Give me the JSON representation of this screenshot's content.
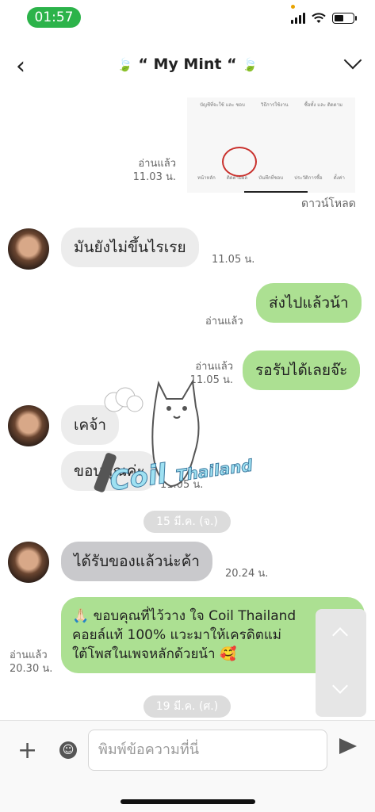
{
  "status_bar": {
    "time": "01:57"
  },
  "header": {
    "leaf_left": "🍃",
    "title": "“ My Mint “",
    "leaf_right": "🍃"
  },
  "screenshot_preview": {
    "top_labels": [
      "บัญชีที่จะใช้ และ ชอบ",
      "วิธีการใช้งาน",
      "ซื้อทั้ง และ ติดตาม"
    ],
    "tab_labels": [
      "หน้าหลัก",
      "ติดตามผล",
      "บันทึกที่ชอบ",
      "ประวัติการซื้อ",
      "ตั้งค่า"
    ]
  },
  "messages": [
    {
      "id": "m0",
      "meta": "อ่านแล้ว\n11.03 น.",
      "extra": "ดาวน์โหลด"
    },
    {
      "id": "m1",
      "text": "มันยังไม่ขึ้นไรเรย",
      "time": "11.05 น."
    },
    {
      "id": "m2",
      "text": "ส่งไปแล้วน้า",
      "meta": "อ่านแล้ว"
    },
    {
      "id": "m3",
      "text": "รอรับได้เลยจ๊ะ",
      "meta": "อ่านแล้ว\n11.05 น."
    },
    {
      "id": "m4",
      "text": "เคจ้า"
    },
    {
      "id": "m5",
      "text": "ขอบคุณค่ะ",
      "time": "11.05 น."
    },
    {
      "id": "m6",
      "text": "ได้รับของแล้วน่ะค้า",
      "time": "20.24 น."
    },
    {
      "id": "m7",
      "line1": "🙏🏻 ขอบคุณที่ไว้วาง ใจ Coil Thailand",
      "line2": "คอยล์แท้ 100% แวะมาให้เครดิตแม่",
      "line3": "ใต้โพสในเพจหลักด้วยน้า 🥰",
      "meta": "อ่านแล้ว\n20.30 น."
    }
  ],
  "date_separators": [
    "15 มี.ค. (จ.)",
    "19 มี.ค. (ศ.)"
  ],
  "watermark": {
    "big": "Coil",
    "small": "Thailand"
  },
  "input": {
    "placeholder": "พิมพ์ข้อความที่นี่"
  },
  "colors": {
    "status_pill": "#2cb34a",
    "outgoing_bubble": "#ace092",
    "incoming_bubble": "#ececec"
  }
}
